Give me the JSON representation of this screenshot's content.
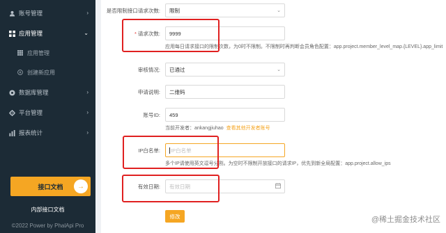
{
  "sidebar": {
    "items": [
      {
        "label": "账号管理",
        "icon": "user-icon",
        "chevron": "›"
      },
      {
        "label": "应用管理",
        "icon": "grid-icon",
        "chevron": "⌄"
      },
      {
        "label": "数据库管理",
        "icon": "database-icon",
        "chevron": "›"
      },
      {
        "label": "平台管理",
        "icon": "gear-icon",
        "chevron": "›"
      },
      {
        "label": "报表统计",
        "icon": "bar-chart-icon",
        "chevron": "›"
      }
    ],
    "sub_items": [
      {
        "label": "应用管理",
        "icon": "grid-icon"
      },
      {
        "label": "创建新应用",
        "icon": "plus-circle-icon"
      }
    ],
    "doc_button": "接口文档",
    "doc_arrow": "→",
    "internal_doc": "内部接口文档",
    "copyright": "©2022 Power by PhalApi Pro"
  },
  "form": {
    "limit": {
      "label": "是否限制接口请求次数:",
      "value": "限制"
    },
    "request_count": {
      "label": "请求次数:",
      "required_mark": "*",
      "value": "9999",
      "help": "应用每日请求接口的限制次数，为0时不限制。不限制时再判断会员角色配置：app.project.member_level_map.{LEVEL}.app_limit"
    },
    "audit": {
      "label": "审核情况:",
      "value": "已通过"
    },
    "description": {
      "label": "申请说明:",
      "value": "二维码"
    },
    "account_id": {
      "label": "账号ID:",
      "value": "459",
      "help": "当前开发者：ankangjiuhao",
      "help_link": "查看其他开发者账号"
    },
    "ip_whitelist": {
      "label": "IP白名单:",
      "placeholder": "IP白名单",
      "help": "多个IP请使用英文逗号分割。为空时不限制开放接口的请求IP，优先到新全局配置：app.project.allow_ips"
    },
    "expiry": {
      "label": "有效日期:",
      "placeholder": "有效日期",
      "icon": "calendar-icon"
    },
    "submit": "修改"
  },
  "watermark": "@稀土掘金技术社区",
  "colors": {
    "accent": "#f5a623",
    "sidebar_bg": "#1c2b36",
    "highlight": "#e02020"
  }
}
